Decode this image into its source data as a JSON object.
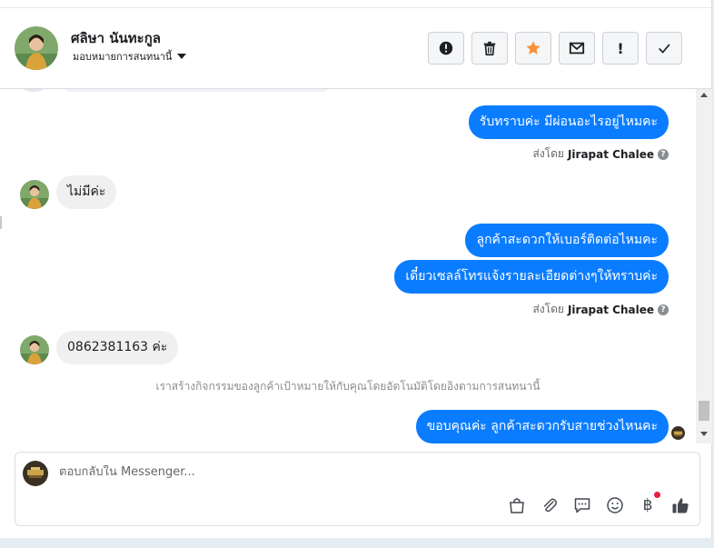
{
  "header": {
    "contact_name": "ศลิษา นันทะกูล",
    "assign_label": "มอบหมายการสนทนานี้"
  },
  "actions": [
    {
      "name": "spam-button",
      "icon": "alert-circle-icon"
    },
    {
      "name": "delete-button",
      "icon": "trash-icon"
    },
    {
      "name": "star-button",
      "icon": "star-icon",
      "color": "#f7923a"
    },
    {
      "name": "mark-unread-button",
      "icon": "envelope-icon"
    },
    {
      "name": "follow-up-button",
      "icon": "exclamation-icon",
      "glyph": "!"
    },
    {
      "name": "mark-done-button",
      "icon": "checkmark-icon"
    }
  ],
  "messages": {
    "m1": "รับทราบค่ะ มีผ่อนอะไรอยู่ไหมคะ",
    "sent1_prefix": "ส่งโดย",
    "sent1_name": "Jirapat Chalee",
    "m2": "ไม่มีค่ะ",
    "m3": "ลูกค้าสะดวกให้เบอร์ติดต่อไหมคะ",
    "m4": "เดี๋ยวเซลล์โทรแจ้งรายละเอียดต่างๆให้ทราบค่ะ",
    "sent2_prefix": "ส่งโดย",
    "sent2_name": "Jirapat Chalee",
    "m5": "0862381163 ค่ะ",
    "system_note": "เราสร้างกิจกรรมของลูกค้าเป้าหมายให้กับคุณโดยอัตโนมัติโดยอิงตามการสนทนานี้",
    "m6": "ขอบคุณค่ะ ลูกค้าสะดวกรับสายช่วงไหนคะ",
    "help_glyph": "?"
  },
  "composer": {
    "placeholder": "ตอบกลับใน Messenger...",
    "value": "",
    "tools": [
      "shopping-bag-icon",
      "paperclip-icon",
      "saved-reply-icon",
      "emoji-icon",
      "baht-payment-icon",
      "thumbs-up-icon"
    ],
    "baht_glyph": "฿"
  },
  "colors": {
    "outgoing_bubble": "#0a7cff",
    "incoming_bubble": "#f0f0f0",
    "star": "#f7923a",
    "notification_dot": "#e41e3f"
  }
}
